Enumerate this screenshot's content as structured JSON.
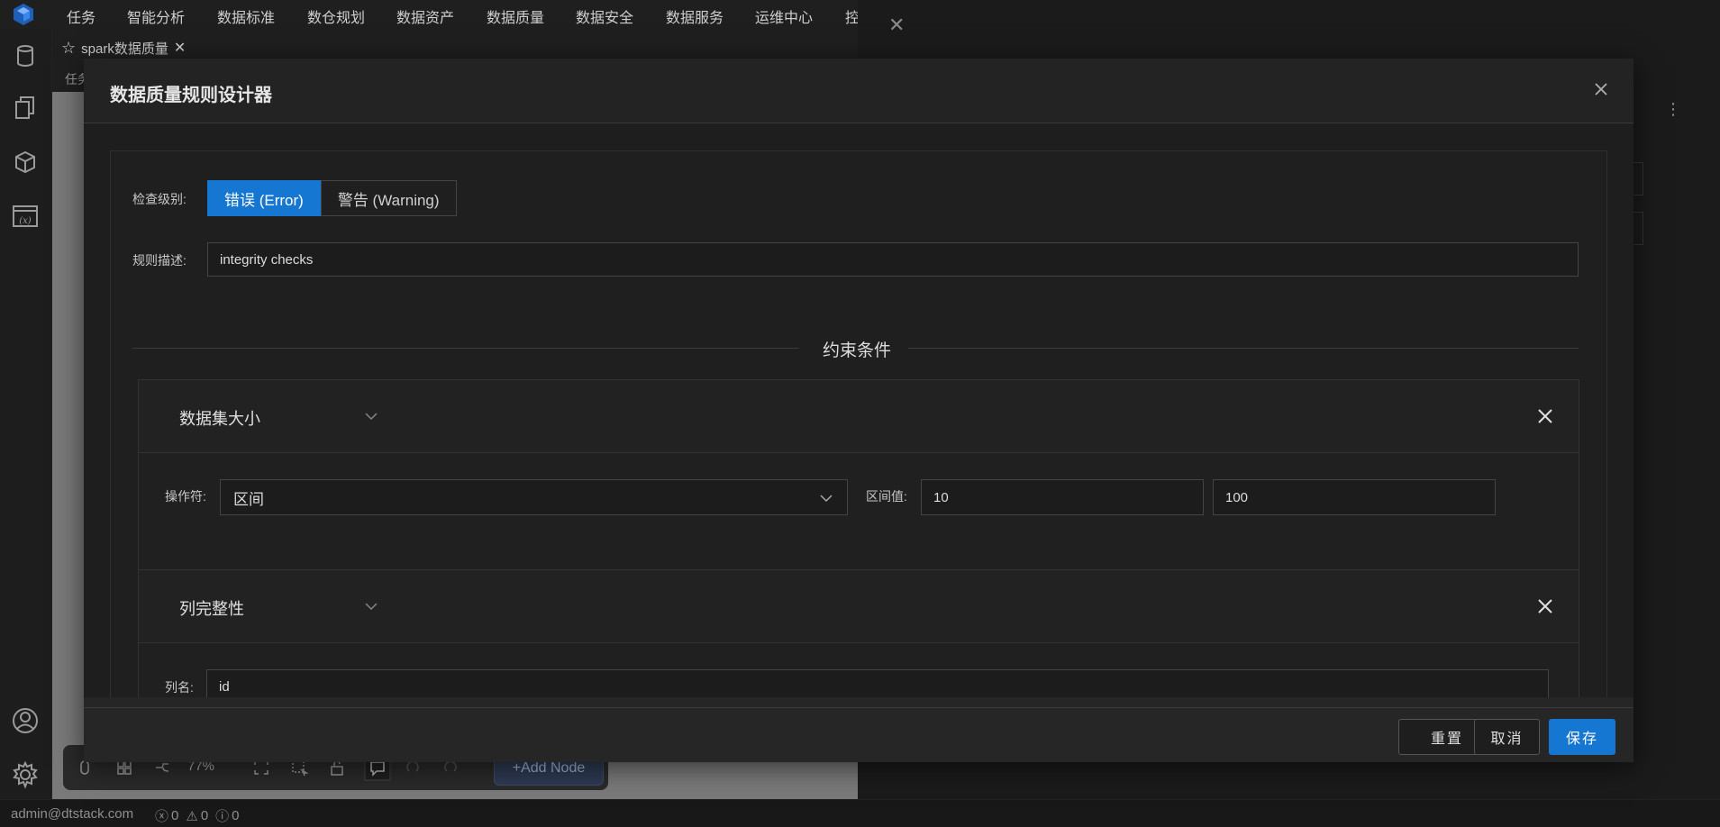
{
  "topnav": {
    "items": [
      "任务",
      "智能分析",
      "数据标准",
      "数仓规划",
      "数据资产",
      "数据质量",
      "数据安全",
      "数据服务",
      "运维中心",
      "控"
    ]
  },
  "tab": {
    "label": "spark数据质量"
  },
  "sub_strip": {
    "text": "任务"
  },
  "toolbar": {
    "zoom": "77%",
    "add_node_label": "+Add Node"
  },
  "footer": {
    "user": "admin@dtstack.com",
    "errors": "0",
    "warnings": "0",
    "infos": "0"
  },
  "modal": {
    "title": "数据质量规则设计器",
    "check_level_label": "检查级别:",
    "level_options": [
      "错误 (Error)",
      "警告 (Warning)"
    ],
    "selected_level": "错误 (Error)",
    "description_label": "规则描述:",
    "description_value": "integrity checks",
    "section_title": "约束条件",
    "conditions": [
      {
        "title": "数据集大小",
        "operator_label": "操作符:",
        "operator_value": "区间",
        "range_label": "区间值:",
        "range_min": "10",
        "range_max": "100"
      },
      {
        "title": "列完整性",
        "column_label": "列名:",
        "column_value": "id"
      }
    ],
    "buttons": {
      "reset": "重置",
      "cancel": "取消",
      "save": "保存"
    }
  },
  "colors": {
    "primary": "#1677d2",
    "background": "#181818",
    "modal": "#262626"
  }
}
